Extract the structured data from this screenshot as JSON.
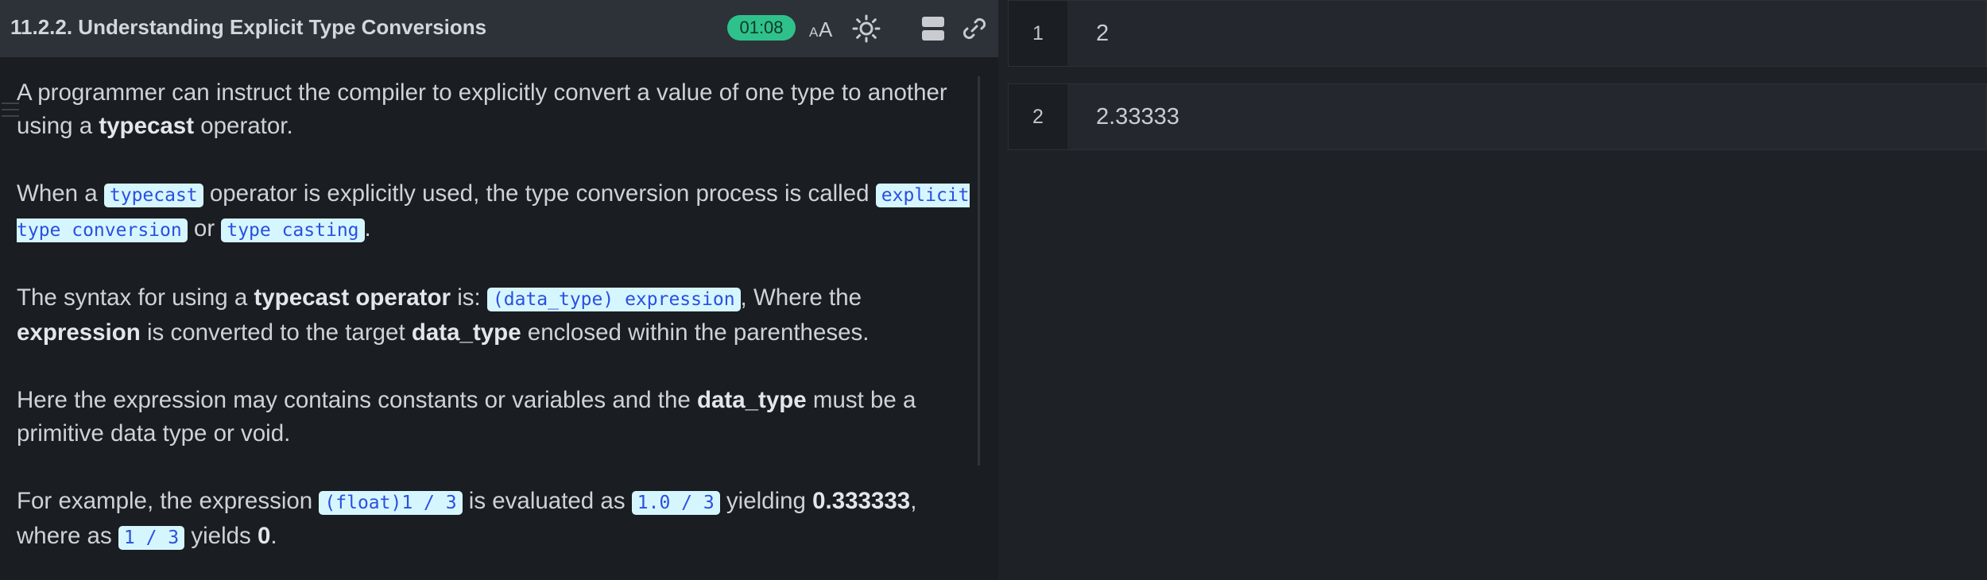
{
  "lesson": {
    "title": "11.2.2. Understanding Explicit Type Conversions",
    "timer": "01:08",
    "icons": [
      "font-size-icon",
      "theme-toggle-icon",
      "layout-icon",
      "link-icon"
    ],
    "p1": {
      "t1": "A programmer can instruct the compiler to explicitly convert a value of one type to another using a ",
      "b1": "typecast",
      "t2": " operator."
    },
    "p2": {
      "t1": "When a ",
      "c1": "typecast",
      "t2": " operator is explicitly used, the type conversion process is called ",
      "c2": "explicit type conversion",
      "t3": " or ",
      "c3": "type casting",
      "t4": "."
    },
    "p3": {
      "t1": "The syntax for using a ",
      "b1": "typecast operator",
      "t2": " is: ",
      "c1": "(data_type) expression",
      "t3": ", Where the ",
      "b2": "expression",
      "t4": " is converted to the target ",
      "b3": "data_type",
      "t5": " enclosed within the parentheses."
    },
    "p4": {
      "t1": "Here the expression may contains constants or variables and the ",
      "b1": "data_type",
      "t2": " must be a primitive data type or void."
    },
    "p5": {
      "t1": "For example, the expression ",
      "c1": "(float)1 / 3",
      "t2": " is evaluated as ",
      "c2": "1.0 / 3",
      "t3": " yielding ",
      "b1": "0.333333",
      "t4": ", where as ",
      "c3": "1 / 3",
      "t5": " yields ",
      "b2": "0",
      "t6": "."
    }
  },
  "output": {
    "rows": [
      {
        "num": "1",
        "value": "2"
      },
      {
        "num": "2",
        "value": "2.33333"
      }
    ]
  },
  "colors": {
    "timer_bg": "#2fc18c",
    "code_bg": "#d6f6ff",
    "code_fg": "#2a4fe0",
    "header_bg": "#2d3239"
  }
}
